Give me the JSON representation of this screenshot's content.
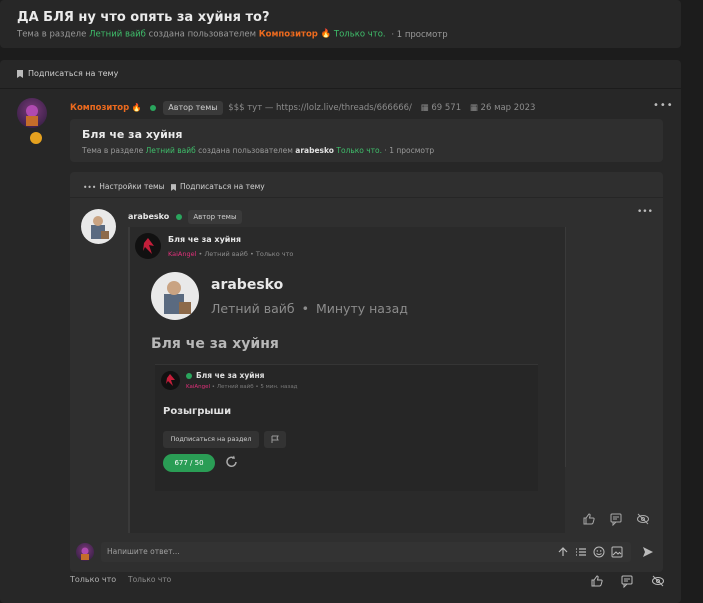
{
  "thread": {
    "title": "ДА БЛЯ ну что опять за хуйня то?",
    "meta_prefix": "Тема в разделе",
    "section": "Летний вайб",
    "meta_created_by": "создана пользователем",
    "author": "Композитор",
    "time": "Только что.",
    "views": "· 1 просмотр"
  },
  "subscribe_bar": {
    "label": "Подписаться на тему"
  },
  "post": {
    "author": "Композитор",
    "badge": "Автор темы",
    "text": "$$$ тут — https://lolz.live/threads/666666/",
    "likes": "69 571",
    "date": "26 мар 2023",
    "footer_time": "Только что"
  },
  "embedded_thread": {
    "title": "Бля че за хуйня",
    "meta_prefix": "Тема в разделе",
    "section": "Летний вайб",
    "meta_created_by": "создана пользователем",
    "author": "arabesko",
    "time": "Только что.",
    "views": "· 1 просмотр"
  },
  "inner_toolbar": {
    "settings": "Настройки темы",
    "subscribe": "Подписаться на тему"
  },
  "inner_post": {
    "author": "arabesko",
    "badge": "Автор темы",
    "footer_time": "Только что"
  },
  "quote": {
    "title": "Бля че за хуйня",
    "user": "KaiAngel",
    "section": "Летний вайб",
    "time": "Только что"
  },
  "big_card": {
    "author": "arabesko",
    "section": "Летний вайб",
    "sep": "•",
    "time": "Минуту назад",
    "title": "Бля че за хуйня"
  },
  "small_card": {
    "title": "Бля че за хуйня",
    "user": "KaiAngel",
    "section": "Летний вайб",
    "time": "5 мин. назад",
    "heading": "Розыгрыши",
    "subscribe": "Подписаться на раздел",
    "counter": "677 / 50"
  },
  "reply": {
    "placeholder": "Напишите ответ..."
  },
  "colors": {
    "accent_green": "#3fbf6b",
    "author_orange": "#ec6a1e",
    "kai_pink": "#e0307a",
    "bg": "#1c1c1c",
    "panel": "#272727"
  }
}
